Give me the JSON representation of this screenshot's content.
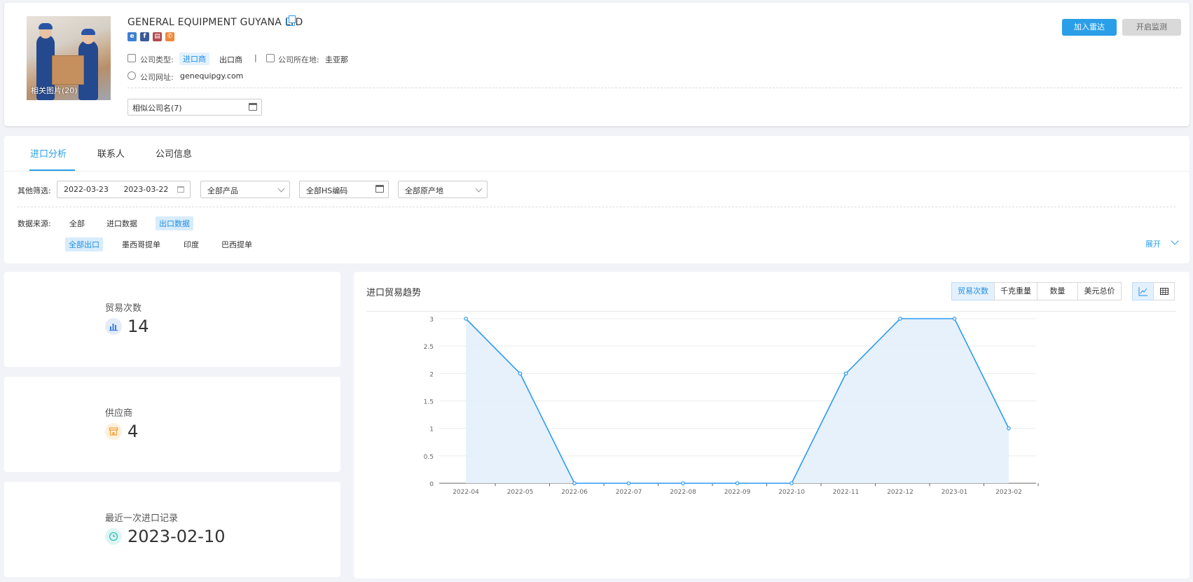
{
  "company": {
    "name": "GENERAL EQUIPMENT GUYANA LTD",
    "photo_caption": "相关图片(20)",
    "type_label": "公司类型:",
    "type_importer": "进口商",
    "type_exporter": "出口商",
    "separator": "|",
    "location_label": "公司所在地:",
    "location_value": "圭亚那",
    "website_label": "公司网址:",
    "website_value": "genequipgy.com",
    "similar_names": "相似公司名(7)"
  },
  "actions": {
    "radar_label": "加入雷达",
    "monitor_label": "开启监测"
  },
  "tabs": [
    {
      "label": "进口分析"
    },
    {
      "label": "联系人"
    },
    {
      "label": "公司信息"
    }
  ],
  "filters": {
    "label": "其他筛选:",
    "date_start": "2022-03-23",
    "date_end": "2023-03-22",
    "product": "全部产品",
    "hs_code": "全部HS编码",
    "origin": "全部原产地",
    "source_label": "数据来源:",
    "sources": [
      "全部",
      "进口数据",
      "出口数据"
    ],
    "sub_sources": [
      "全部出口",
      "墨西哥提单",
      "印度",
      "巴西提单"
    ],
    "expand_label": "展开"
  },
  "stats": [
    {
      "label": "贸易次数",
      "value": "14",
      "icon": "bar-chart-icon",
      "color": "#3d7fe0"
    },
    {
      "label": "供应商",
      "value": "4",
      "icon": "store-icon",
      "color": "#f0a33a"
    },
    {
      "label": "最近一次进口记录",
      "value": "2023-02-10",
      "icon": "clock-icon",
      "color": "#2bbfb8"
    }
  ],
  "chart_toolbar": {
    "title": "进口贸易趋势",
    "metrics": [
      "贸易次数",
      "千克重量",
      "数量",
      "美元总价"
    ],
    "active_metric": "贸易次数",
    "views": [
      "line-chart-icon",
      "table-icon"
    ]
  },
  "chart_data": {
    "type": "area",
    "categories": [
      "2022-04",
      "2022-05",
      "2022-06",
      "2022-07",
      "2022-08",
      "2022-09",
      "2022-10",
      "2022-11",
      "2022-12",
      "2023-01",
      "2023-02"
    ],
    "values": [
      3,
      2,
      0,
      0,
      0,
      0,
      0,
      2,
      3,
      3,
      1
    ],
    "y_ticks": [
      "0",
      "0.5",
      "1",
      "1.5",
      "2",
      "2.5",
      "3"
    ],
    "ylim": [
      0,
      3
    ],
    "title": "",
    "xlabel": "",
    "ylabel": "",
    "grid": true,
    "line_color": "#2b9af3",
    "fill_color": "#e3f0fb"
  }
}
